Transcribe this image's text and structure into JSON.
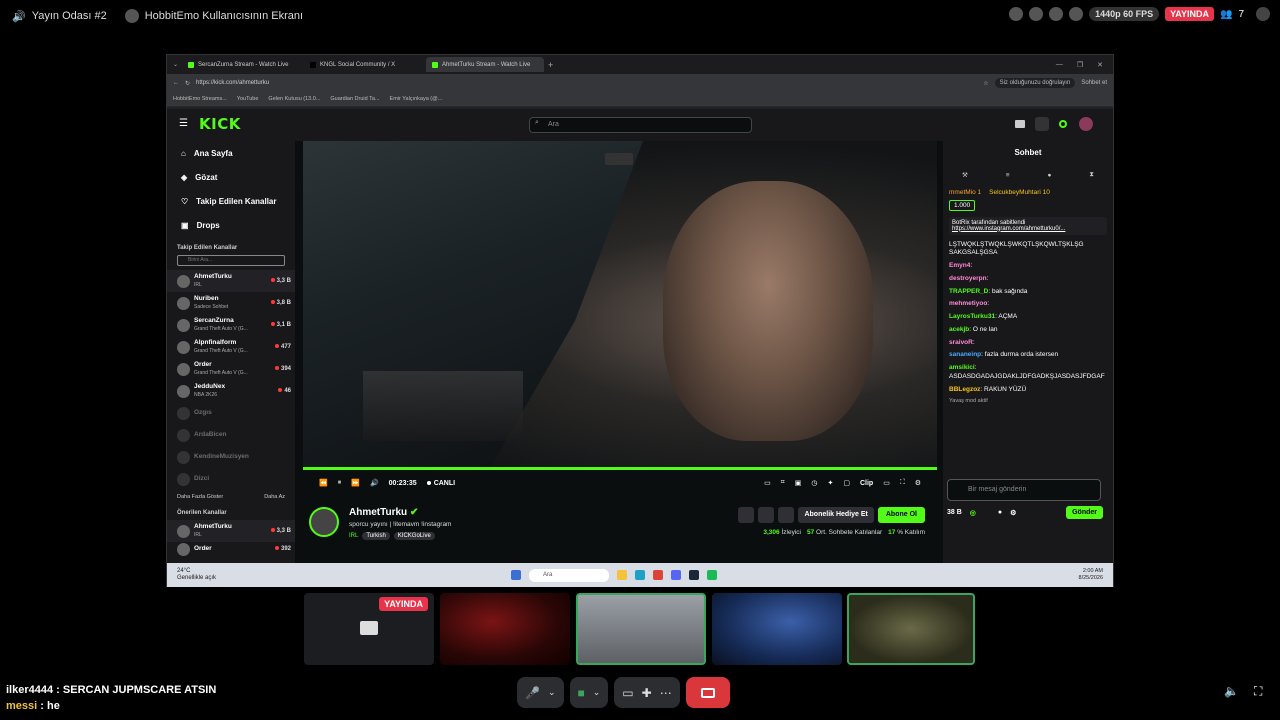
{
  "discord": {
    "room_title": "Yayın Odası #2",
    "screen_title": "HobbitEmo Kullanıcısının Ekranı",
    "quality": "1440p 60 FPS",
    "live_badge": "YAYINDA",
    "viewer_count": "7",
    "tile_live_badge": "YAYINDA",
    "chat_lines": [
      {
        "user": "ilker4444",
        "sep": " : ",
        "text": "SERCAN JUPMSCARE ATSIN"
      },
      {
        "user": "messi",
        "sep": " : ",
        "text": "he"
      }
    ]
  },
  "browser": {
    "tabs": [
      {
        "label": "SercanZurna Stream - Watch Live"
      },
      {
        "label": "KNGL Social Community / X"
      },
      {
        "label": "AhmetTurku Stream - Watch Live"
      }
    ],
    "new_tab": "+",
    "url": "https://kick.com/ahmetturku",
    "verify_text": "Siz olduğunuzu doğrulayın",
    "profile_text": "Sohbet et",
    "bookmarks": [
      "HobbitEmo Streams...",
      "YouTube",
      "Gelen Kutusu (13.0...",
      "Guardian Druid Ta...",
      "Emir Yalçınkaya (@..."
    ]
  },
  "kick": {
    "logo": "KICK",
    "search_placeholder": "Ara",
    "nav": [
      {
        "label": "Ana Sayfa",
        "icon": "home-icon"
      },
      {
        "label": "Gözat",
        "icon": "browse-icon"
      },
      {
        "label": "Takip Edilen Kanallar",
        "icon": "heart-icon"
      },
      {
        "label": "Drops",
        "icon": "drops-icon"
      }
    ],
    "followed_header": "Takip Edilen Kanallar",
    "sidebar_search": "Birini Ara...",
    "followed": [
      {
        "name": "AhmetTurku",
        "sub": "IRL",
        "viewers": "3,3 B"
      },
      {
        "name": "Nuriben",
        "sub": "Sadece Sohbet",
        "viewers": "3,8 B"
      },
      {
        "name": "SercanZurna",
        "sub": "Grand Theft Auto V (G...",
        "viewers": "3,1 B"
      },
      {
        "name": "Alpnfinalform",
        "sub": "Grand Theft Auto V (G...",
        "viewers": "477"
      },
      {
        "name": "Order",
        "sub": "Grand Theft Auto V (G...",
        "viewers": "394"
      },
      {
        "name": "JedduNex",
        "sub": "NBA 2K26",
        "viewers": "46"
      }
    ],
    "offline": [
      "Ozgıs",
      "ArdaBicen",
      "KendineMuzisyen",
      "Dizci"
    ],
    "show_more": "Daha Fazla Göster",
    "show_less": "Daha Az",
    "recommended_header": "Önerilen Kanallar",
    "recommended": [
      {
        "name": "AhmetTurku",
        "sub": "IRL",
        "viewers": "3,3 B"
      },
      {
        "name": "Order",
        "sub": "",
        "viewers": "392"
      }
    ],
    "player": {
      "time": "00:23:35",
      "live": "CANLI",
      "clip": "Clip"
    },
    "channel": {
      "name": "AhmetTurku",
      "title": "sporcu yayını | !itemavm !instagram",
      "category": "IRL",
      "tags": [
        "Turkish",
        "KICKGoLive"
      ],
      "gift_label": "Abonelik Hediye Et",
      "sub_label": "Abone Ol",
      "viewers": "3,306",
      "viewers_label": "İzleyici",
      "uptime": "57",
      "uptime_label": "Ort. Sohbete Katılanlar",
      "ratio": "17",
      "ratio_label": "% Katılım"
    },
    "chat": {
      "title": "Sohbet",
      "top_users": [
        "mmetMio 1",
        "SelcukbeyMuhtari 10"
      ],
      "pinned_badge": "1.000",
      "pinned_by": "BotRix tarafından sabitlendi",
      "pinned_link": "https://www.instagram.com/ahmetturku0/...",
      "spam": "LŞTWQKLŞTWQKLŞWKQTLŞKQWLTŞKLŞG SAKGSALŞGSA",
      "messages": [
        {
          "user": "Emyn4",
          "color": "#ff8ad8",
          "text": ""
        },
        {
          "user": "destroyerpn",
          "color": "#ff8ad8",
          "text": ""
        },
        {
          "user": "TRAPPER_D",
          "color": "#53fc18",
          "text": "bak sağında"
        },
        {
          "user": "mehmetiyoo",
          "color": "#ff8ad8",
          "text": ""
        },
        {
          "user": "LayrosTurku31",
          "color": "#53fc18",
          "text": "AÇMA"
        },
        {
          "user": "acekjb",
          "color": "#53fc18",
          "text": "O ne lan"
        },
        {
          "user": "sraivoR",
          "color": "#ff8ad8",
          "text": ""
        },
        {
          "user": "sananeinp",
          "color": "#4aa8ff",
          "text": "fazla durma orda istersen"
        },
        {
          "user": "amsikici",
          "color": "#53fc18",
          "text": "ASDASDGADAJGDAKLJDFGADKŞJASDASJFDGAF"
        },
        {
          "user": "BBLegzoz",
          "color": "#f5c518",
          "text": "RAKUN YÜZÜ"
        }
      ],
      "slow_mode": "Yavaş mod aktif",
      "input_placeholder": "Bir mesaj gönderin",
      "points": "38 B",
      "send": "Gönder"
    }
  },
  "taskbar": {
    "temp": "24°C",
    "weather": "Genellikle açık",
    "search": "Ara",
    "time": "2:00 AM",
    "date": "8/25/2026"
  }
}
